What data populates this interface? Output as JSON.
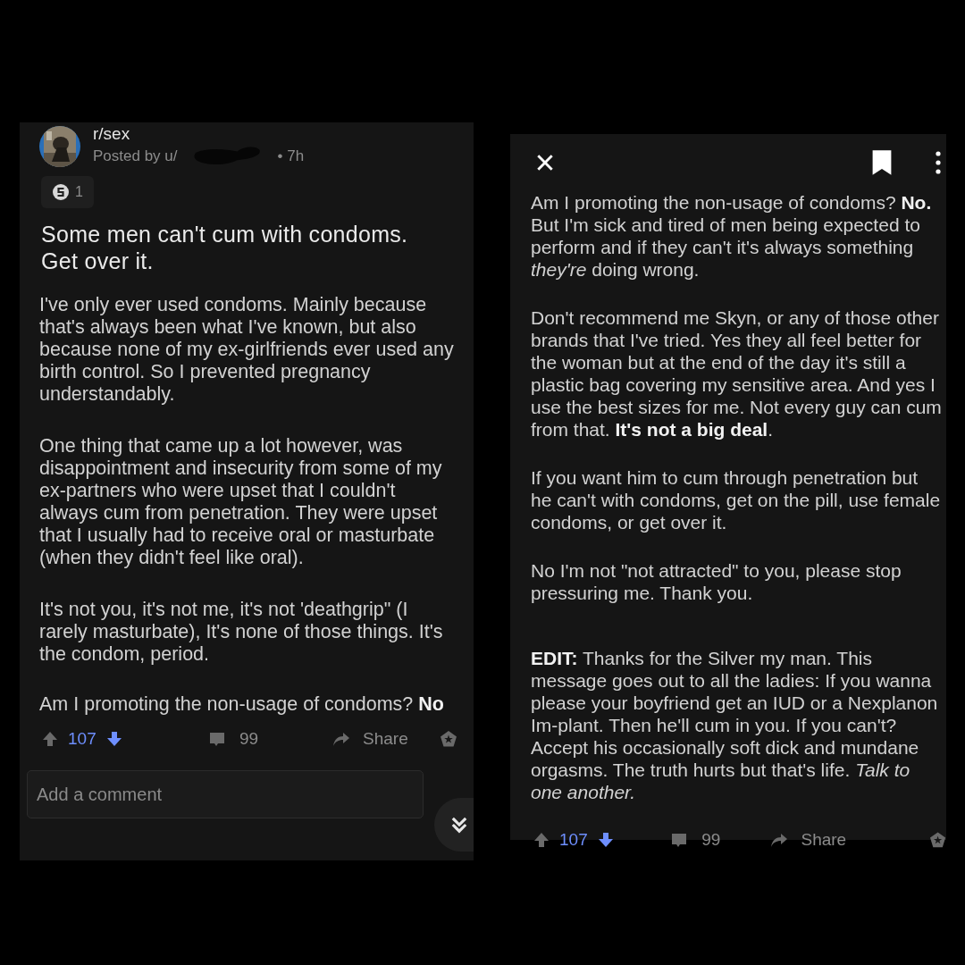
{
  "panels": [
    {
      "kind": "post",
      "subreddit": "r/sex",
      "posted_by": "Posted by u/",
      "time": "• 7h",
      "award_count": "1",
      "title": "Some men can't cum with condoms. Get over it.",
      "paragraphs": [
        "I've only ever used condoms. Mainly because that's always been what I've known, but also because none of my ex-girlfriends ever used any birth control. So I prevented pregnancy understandably.",
        "One thing that came up a lot however, was disappointment and insecurity from some of my ex-partners who were upset that I couldn't always cum from penetration. They were upset that I usually had to receive oral or masturbate (when they didn't feel like oral).",
        "It's not you, it's not me, it's not 'deathgrip\" (I rarely masturbate), It's none of those things. It's the condom, period.",
        "Am I promoting the non-usage of condoms? **No**"
      ],
      "upvote": {
        "selected": false
      },
      "downvote": {
        "selected": true
      },
      "score": "107",
      "comments": "99",
      "share": "Share",
      "comment_field": {
        "placeholder": "Add a comment"
      }
    },
    {
      "kind": "expanded",
      "paragraphs": [
        "Am I promoting the non-usage of condoms? **No.** But I'm sick and tired of men being expected to perform and if they can't it's always something *they're* doing wrong.",
        "Don't recommend me Skyn, or any of those other brands that I've tried. Yes they all feel better for the woman but at the end of the day it's still a plastic bag covering my sensitive area. And yes I use the best sizes for me. Not every guy can cum from that. **It's not a big deal**.",
        "If you want him to cum through penetration but he can't with condoms, get on the pill, use female condoms, or get over it.",
        "No I'm not \"not attracted\" to you, please stop pressuring me. Thank you.",
        "**EDIT:** Thanks for the Silver my man. This message goes out to all the ladies: If you wanna please your boyfriend get an IUD or a Nexplanon Im-plant. Then he'll cum in you. If you can't? Accept his occasionally soft dick and mundane orgasms. The truth hurts but that's life. *Talk to one another.*"
      ],
      "upvote": {
        "selected": false
      },
      "downvote": {
        "selected": true
      },
      "score": "107",
      "comments": "99",
      "share": "Share"
    }
  ]
}
